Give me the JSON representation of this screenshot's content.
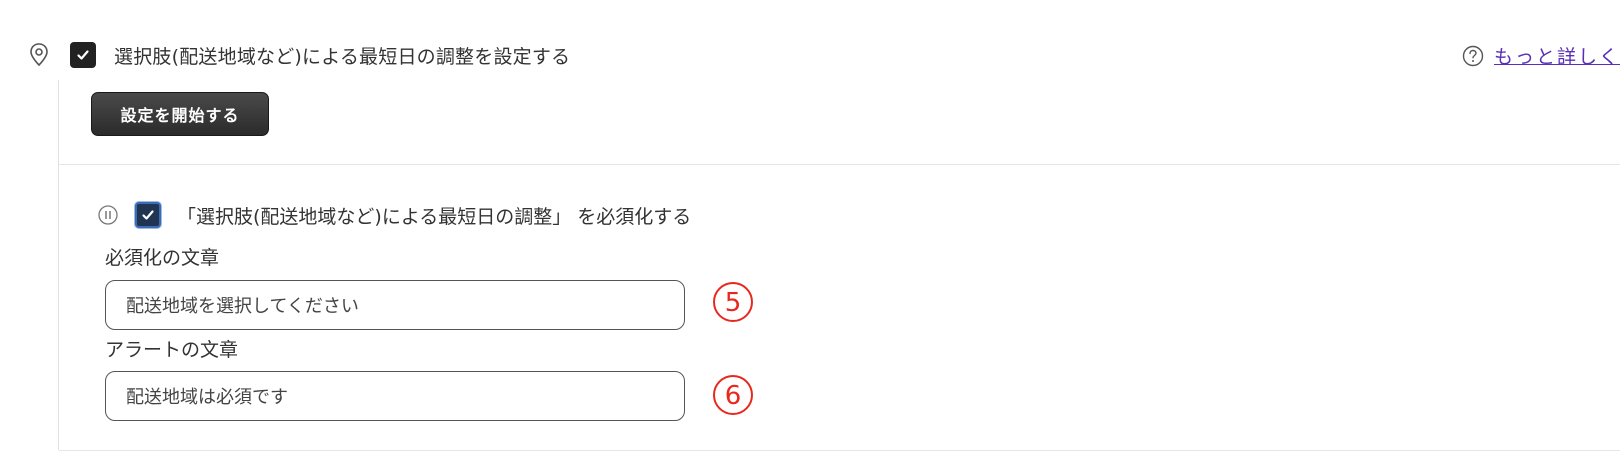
{
  "main_option": {
    "label": "選択肢(配送地域など)による最短日の調整を設定する",
    "checked": true,
    "icon": "map-pin-icon"
  },
  "help": {
    "icon": "question-circle-icon",
    "link_text": "もっと詳しく"
  },
  "start_button": {
    "label": "設定を開始する"
  },
  "required_option": {
    "label": "「選択肢(配送地域など)による最短日の調整」 を必須化する",
    "checked": true,
    "icon": "pause-circle-icon"
  },
  "required_text": {
    "label": "必須化の文章",
    "value": "配送地域を選択してください",
    "marker": "⑤"
  },
  "alert_text": {
    "label": "アラートの文章",
    "value": "配送地域は必須です",
    "marker": "⑥"
  },
  "colors": {
    "marker": "#e8281f",
    "link": "#5a2fb5",
    "checkbox": "#222222",
    "button": "#333333"
  }
}
